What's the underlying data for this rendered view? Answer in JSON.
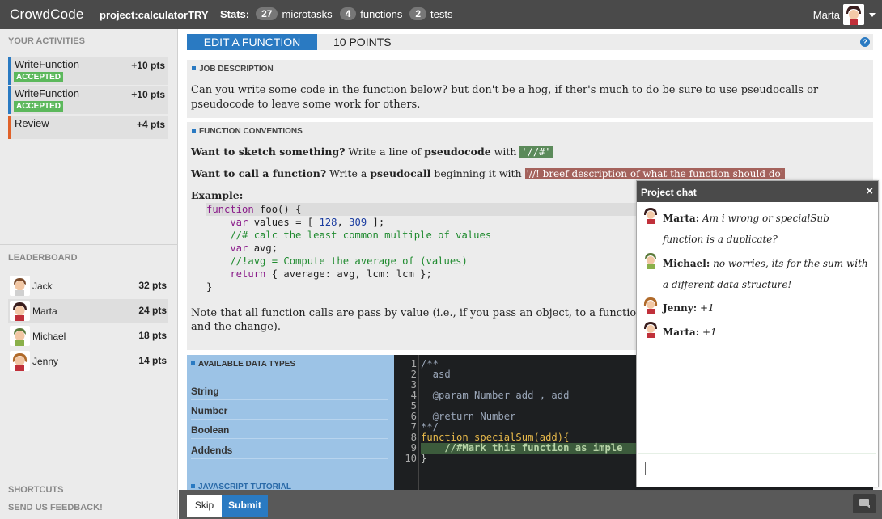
{
  "app": {
    "brand": "CrowdCode",
    "project_label": "project:",
    "project_name": "calculatorTRY"
  },
  "stats": {
    "label": "Stats:",
    "items": [
      {
        "count": "27",
        "label": "microtasks"
      },
      {
        "count": "4",
        "label": "functions"
      },
      {
        "count": "2",
        "label": "tests"
      }
    ]
  },
  "user": {
    "name": "Marta"
  },
  "sidebar": {
    "activities_title": "YOUR ACTIVITIES",
    "activities": [
      {
        "name": "WriteFunction",
        "points": "+10 pts",
        "badge": "ACCEPTED"
      },
      {
        "name": "WriteFunction",
        "points": "+10 pts",
        "badge": "ACCEPTED"
      },
      {
        "name": "Review",
        "points": "+4 pts",
        "badge": ""
      }
    ],
    "leaderboard_title": "LEADERBOARD",
    "leaderboard": [
      {
        "name": "Jack",
        "points": "32 pts"
      },
      {
        "name": "Marta",
        "points": "24 pts"
      },
      {
        "name": "Michael",
        "points": "18 pts"
      },
      {
        "name": "Jenny",
        "points": "14 pts"
      }
    ],
    "shortcuts": "SHORTCUTS",
    "feedback": "SEND US FEEDBACK!"
  },
  "task": {
    "title": "EDIT A FUNCTION",
    "points": "10 POINTS",
    "help": "?",
    "job_title": "JOB DESCRIPTION",
    "job_text": "Can you write some code in the function below? but don't be a hog, if ther's much to do be sure to use pseudocalls or pseudocode to leave some work for others.",
    "conventions_title": "FUNCTION CONVENTIONS",
    "sketch_q": "Want to sketch something?",
    "sketch_text": " Write a line of ",
    "sketch_bold": "pseudocode",
    "sketch_with": " with ",
    "sketch_code": "'//#'",
    "call_q": "Want to call a function?",
    "call_text": " Write a ",
    "call_bold": "pseudocall",
    "call_begin": " beginning it with ",
    "call_code": "'//! breef description of what the function should do'",
    "example_label": "Example:",
    "note_text": "Note that all function calls are pass by value (i.e., if you pass an object, to a function and the change)."
  },
  "example_code": [
    {
      "kw": "function",
      "rest": " foo() {"
    },
    {
      "kw": "    var",
      "rest": " values = [ ",
      "n1": "128",
      "mid": ", ",
      "n2": "309",
      "end": " ];"
    },
    {
      "cm": "    //# calc the least common multiple of values"
    },
    {
      "kw": "    var",
      "rest": " avg;"
    },
    {
      "cm": "    //!avg = Compute the average of (values)"
    },
    {
      "kw": "    return",
      "rest": " { average: avg, lcm: lcm };"
    },
    {
      "rest": "}"
    }
  ],
  "datatypes": {
    "title": "AVAILABLE DATA TYPES",
    "items": [
      "String",
      "Number",
      "Boolean",
      "Addends"
    ],
    "tutorial": "JAVASCRIPT TUTORIAL"
  },
  "editor": {
    "line_numbers": [
      "1",
      "2",
      "3",
      "4",
      "5",
      "6",
      "7",
      "8",
      "9",
      "10"
    ],
    "lines": [
      "/**",
      "  asd",
      "",
      "  @param Number add , add",
      "",
      "  @return Number",
      "**/",
      "function specialSum(add){",
      "    //#Mark this function as imple",
      "}"
    ]
  },
  "footer": {
    "skip": "Skip",
    "submit": "Submit"
  },
  "chat": {
    "title": "Project chat",
    "close": "×",
    "messages": [
      {
        "author": "Marta:",
        "text": "Am i wrong or specialSub function is a duplicate?"
      },
      {
        "author": "Michael:",
        "text": "no worries, its for the sum with a different data structure!"
      },
      {
        "author": "Jenny:",
        "text": "+1"
      },
      {
        "author": "Marta:",
        "text": "+1"
      }
    ]
  },
  "colors": {
    "accent": "#2a7ac2",
    "accepted": "#5cb85c",
    "review": "#e0622a",
    "topbar": "#4a4a4a"
  }
}
